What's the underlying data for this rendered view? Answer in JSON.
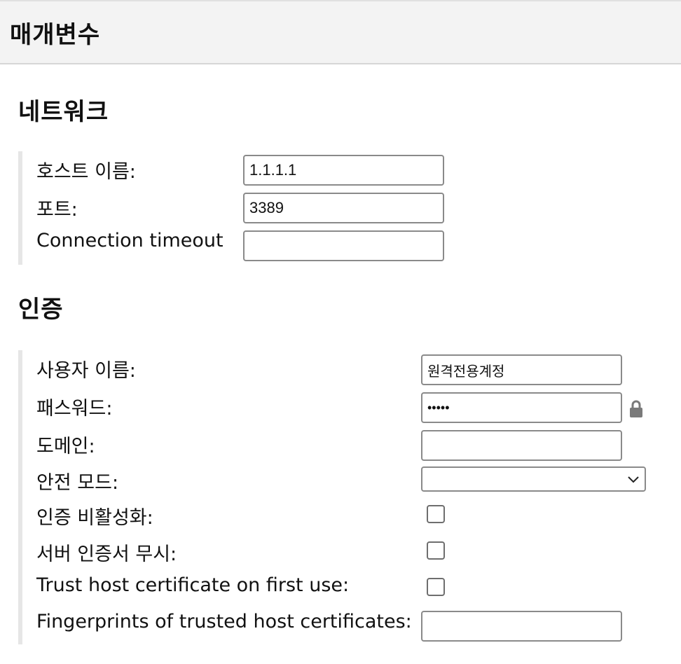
{
  "header": {
    "title": "매개변수"
  },
  "network": {
    "title": "네트워크",
    "hostname": {
      "label": "호스트 이름:",
      "value": "1.1.1.1"
    },
    "port": {
      "label": "포트:",
      "value": "3389"
    },
    "timeout": {
      "label": "Connection timeout",
      "value": ""
    }
  },
  "auth": {
    "title": "인증",
    "username": {
      "label": "사용자 이름:",
      "value": "원격전용계정"
    },
    "password": {
      "label": "패스워드:",
      "value": "•••••",
      "icon": "lock-icon"
    },
    "domain": {
      "label": "도메인:",
      "value": ""
    },
    "security_mode": {
      "label": "안전 모드:",
      "value": "",
      "icon": "chevron-down-icon"
    },
    "disable_auth": {
      "label": "인증 비활성화:",
      "checked": false
    },
    "ignore_cert": {
      "label": "서버 인증서 무시:",
      "checked": false
    },
    "trust_first_use": {
      "label": "Trust host certificate on first use:",
      "checked": false
    },
    "fingerprints": {
      "label": "Fingerprints of trusted host certificates:",
      "value": ""
    }
  },
  "colors": {
    "header_bg": "#f3f3f3",
    "group_border": "#e6e6e6",
    "input_border": "#8a8a8a",
    "lock": "#7a7a7a"
  }
}
